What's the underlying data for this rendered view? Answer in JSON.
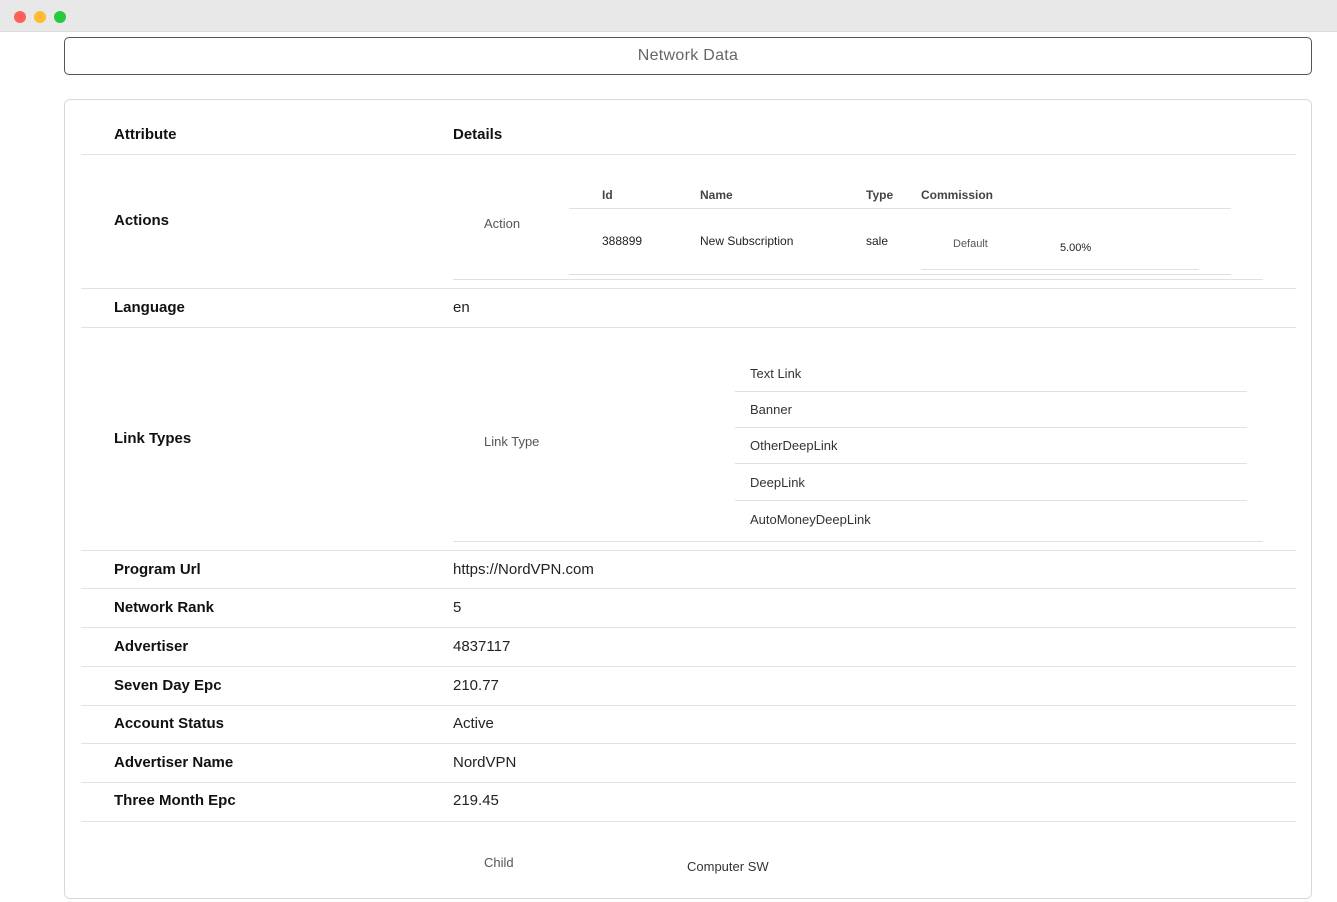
{
  "window": {
    "controls": [
      "close",
      "minimize",
      "maximize"
    ]
  },
  "header": {
    "title": "Network Data"
  },
  "table": {
    "col_attribute": "Attribute",
    "col_details": "Details",
    "actions": {
      "label": "Actions",
      "sub_label": "Action",
      "headers": {
        "id": "Id",
        "name": "Name",
        "type": "Type",
        "commission": "Commission"
      },
      "row": {
        "id": "388899",
        "name": "New Subscription",
        "type": "sale",
        "commission_label": "Default",
        "commission_value": "5.00%"
      }
    },
    "language": {
      "label": "Language",
      "value": "en"
    },
    "link_types": {
      "label": "Link Types",
      "sub_label": "Link Type",
      "items": [
        "Text Link",
        "Banner",
        "OtherDeepLink",
        "DeepLink",
        "AutoMoneyDeepLink"
      ]
    },
    "program_url": {
      "label": "Program Url",
      "value": "https://NordVPN.com"
    },
    "network_rank": {
      "label": "Network Rank",
      "value": "5"
    },
    "advertiser": {
      "label": "Advertiser",
      "value": "4837117"
    },
    "seven_day_epc": {
      "label": "Seven Day Epc",
      "value": "210.77"
    },
    "account_status": {
      "label": "Account Status",
      "value": "Active"
    },
    "advertiser_name": {
      "label": "Advertiser Name",
      "value": "NordVPN"
    },
    "three_month_epc": {
      "label": "Three Month Epc",
      "value": "219.45"
    },
    "category": {
      "sub_label": "Child",
      "value": "Computer SW"
    }
  }
}
